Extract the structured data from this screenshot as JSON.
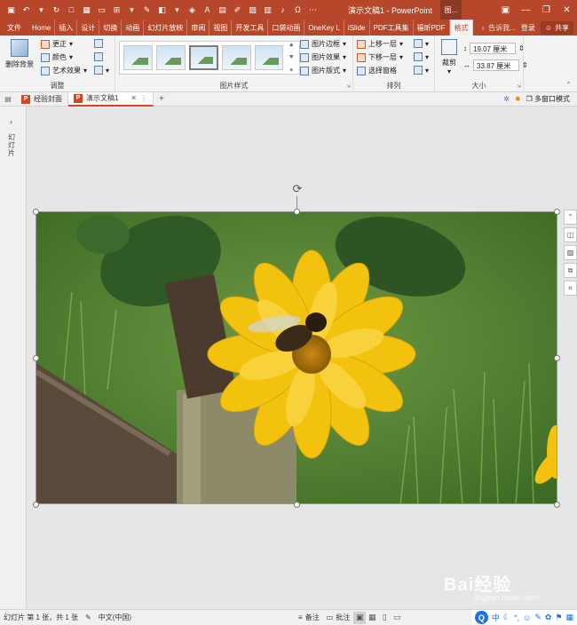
{
  "titlebar": {
    "title": "演示文稿1 - PowerPoint",
    "context_label": "图..."
  },
  "tabs": {
    "file": "文件",
    "items": [
      "Home",
      "插入",
      "设计",
      "切换",
      "动画",
      "幻灯片放映",
      "审阅",
      "视图",
      "开发工具",
      "口袋动画",
      "OneKey L",
      "iSlide",
      "PDF工具集",
      "福昕PDF",
      "格式"
    ],
    "active": "格式",
    "tell_me": "告诉我...",
    "login": "登录",
    "share": "共享"
  },
  "ribbon": {
    "adjust": {
      "remove_bg": "删除背景",
      "corrections": "更正",
      "color": "颜色",
      "artistic": "艺术效果",
      "label": "调整"
    },
    "picture_styles": {
      "border": "图片边框",
      "effects": "图片效果",
      "layout": "图片版式",
      "label": "图片样式"
    },
    "arrange": {
      "bring_forward": "上移一层",
      "send_backward": "下移一层",
      "selection_pane": "选择窗格",
      "label": "排列"
    },
    "size": {
      "crop": "裁剪",
      "height": "19.07 厘米",
      "width": "33.87 厘米",
      "label": "大小"
    }
  },
  "docbar": {
    "tab1": "经验封面",
    "tab2": "演示文稿1",
    "add": "+",
    "multi_window": "多窗口模式"
  },
  "leftpane": {
    "label": "幻灯片"
  },
  "statusbar": {
    "slide_info": "幻灯片 第 1 张，共 1 张",
    "language": "中文(中国)",
    "notes": "备注",
    "comments": "批注"
  },
  "ime": {
    "mode": "中"
  },
  "watermark": {
    "brand": "Bai经验",
    "url": "jingyan.baidu.com"
  },
  "colors": {
    "accent": "#b7472a",
    "ribbon_bg": "#f3f3f3",
    "canvas_bg": "#e6e6e6"
  }
}
